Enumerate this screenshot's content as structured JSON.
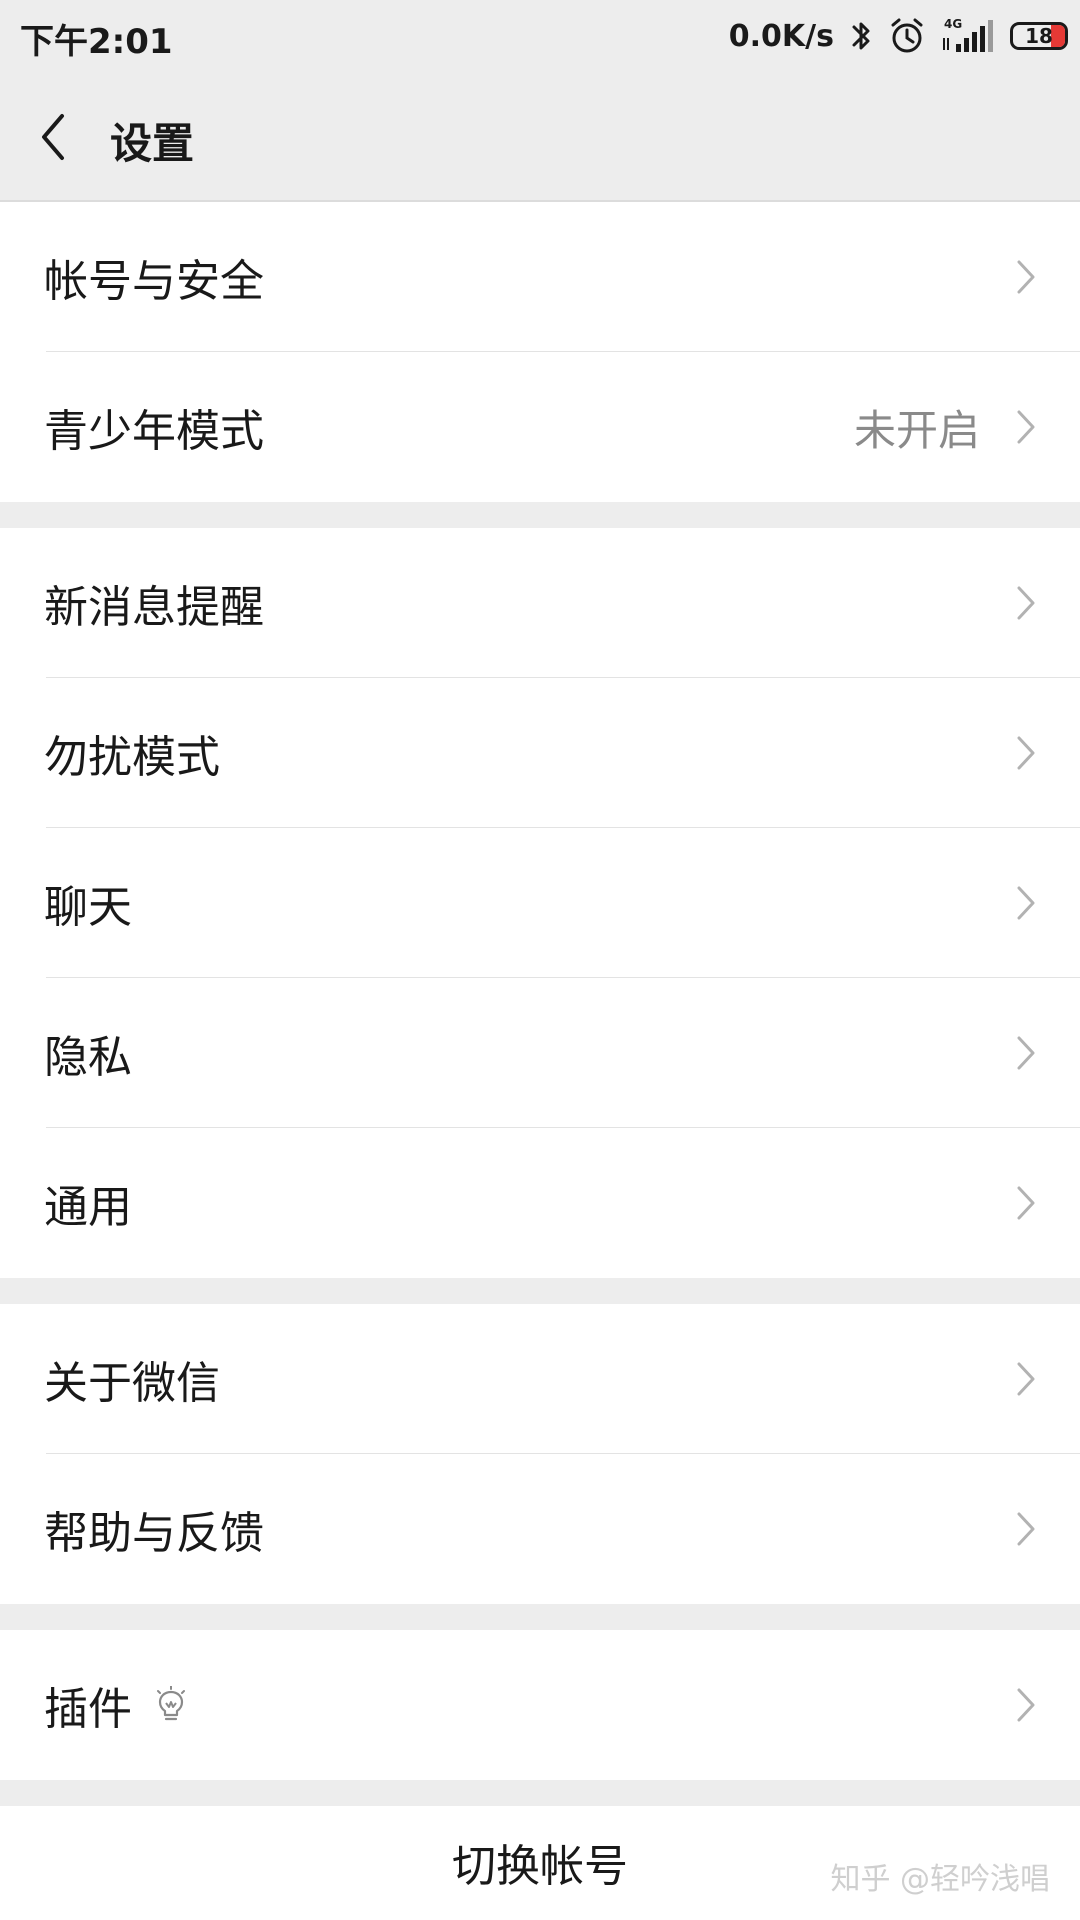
{
  "status_bar": {
    "time": "下午2:01",
    "net_speed": "0.0K/s",
    "network_type": "4G",
    "battery_level": "18",
    "icons": [
      "bluetooth-icon",
      "alarm-icon",
      "signal-icon",
      "battery-icon"
    ]
  },
  "header": {
    "title": "设置",
    "back_icon": "chevron-left-icon"
  },
  "groups": [
    {
      "items": [
        {
          "label": "帐号与安全",
          "value": ""
        },
        {
          "label": "青少年模式",
          "value": "未开启"
        }
      ]
    },
    {
      "items": [
        {
          "label": "新消息提醒",
          "value": ""
        },
        {
          "label": "勿扰模式",
          "value": ""
        },
        {
          "label": "聊天",
          "value": ""
        },
        {
          "label": "隐私",
          "value": ""
        },
        {
          "label": "通用",
          "value": ""
        }
      ]
    },
    {
      "items": [
        {
          "label": "关于微信",
          "value": ""
        },
        {
          "label": "帮助与反馈",
          "value": ""
        }
      ]
    },
    {
      "items": [
        {
          "label": "插件",
          "value": "",
          "icon": "lightbulb-icon"
        }
      ]
    }
  ],
  "footer": {
    "switch_account_label": "切换帐号"
  },
  "watermark": "知乎 @轻吟浅唱",
  "colors": {
    "background": "#ededed",
    "row_background": "#ffffff",
    "text": "#191919",
    "secondary_text": "#8a8a8a",
    "chevron": "#b2b2b2",
    "battery_low": "#e53935"
  }
}
